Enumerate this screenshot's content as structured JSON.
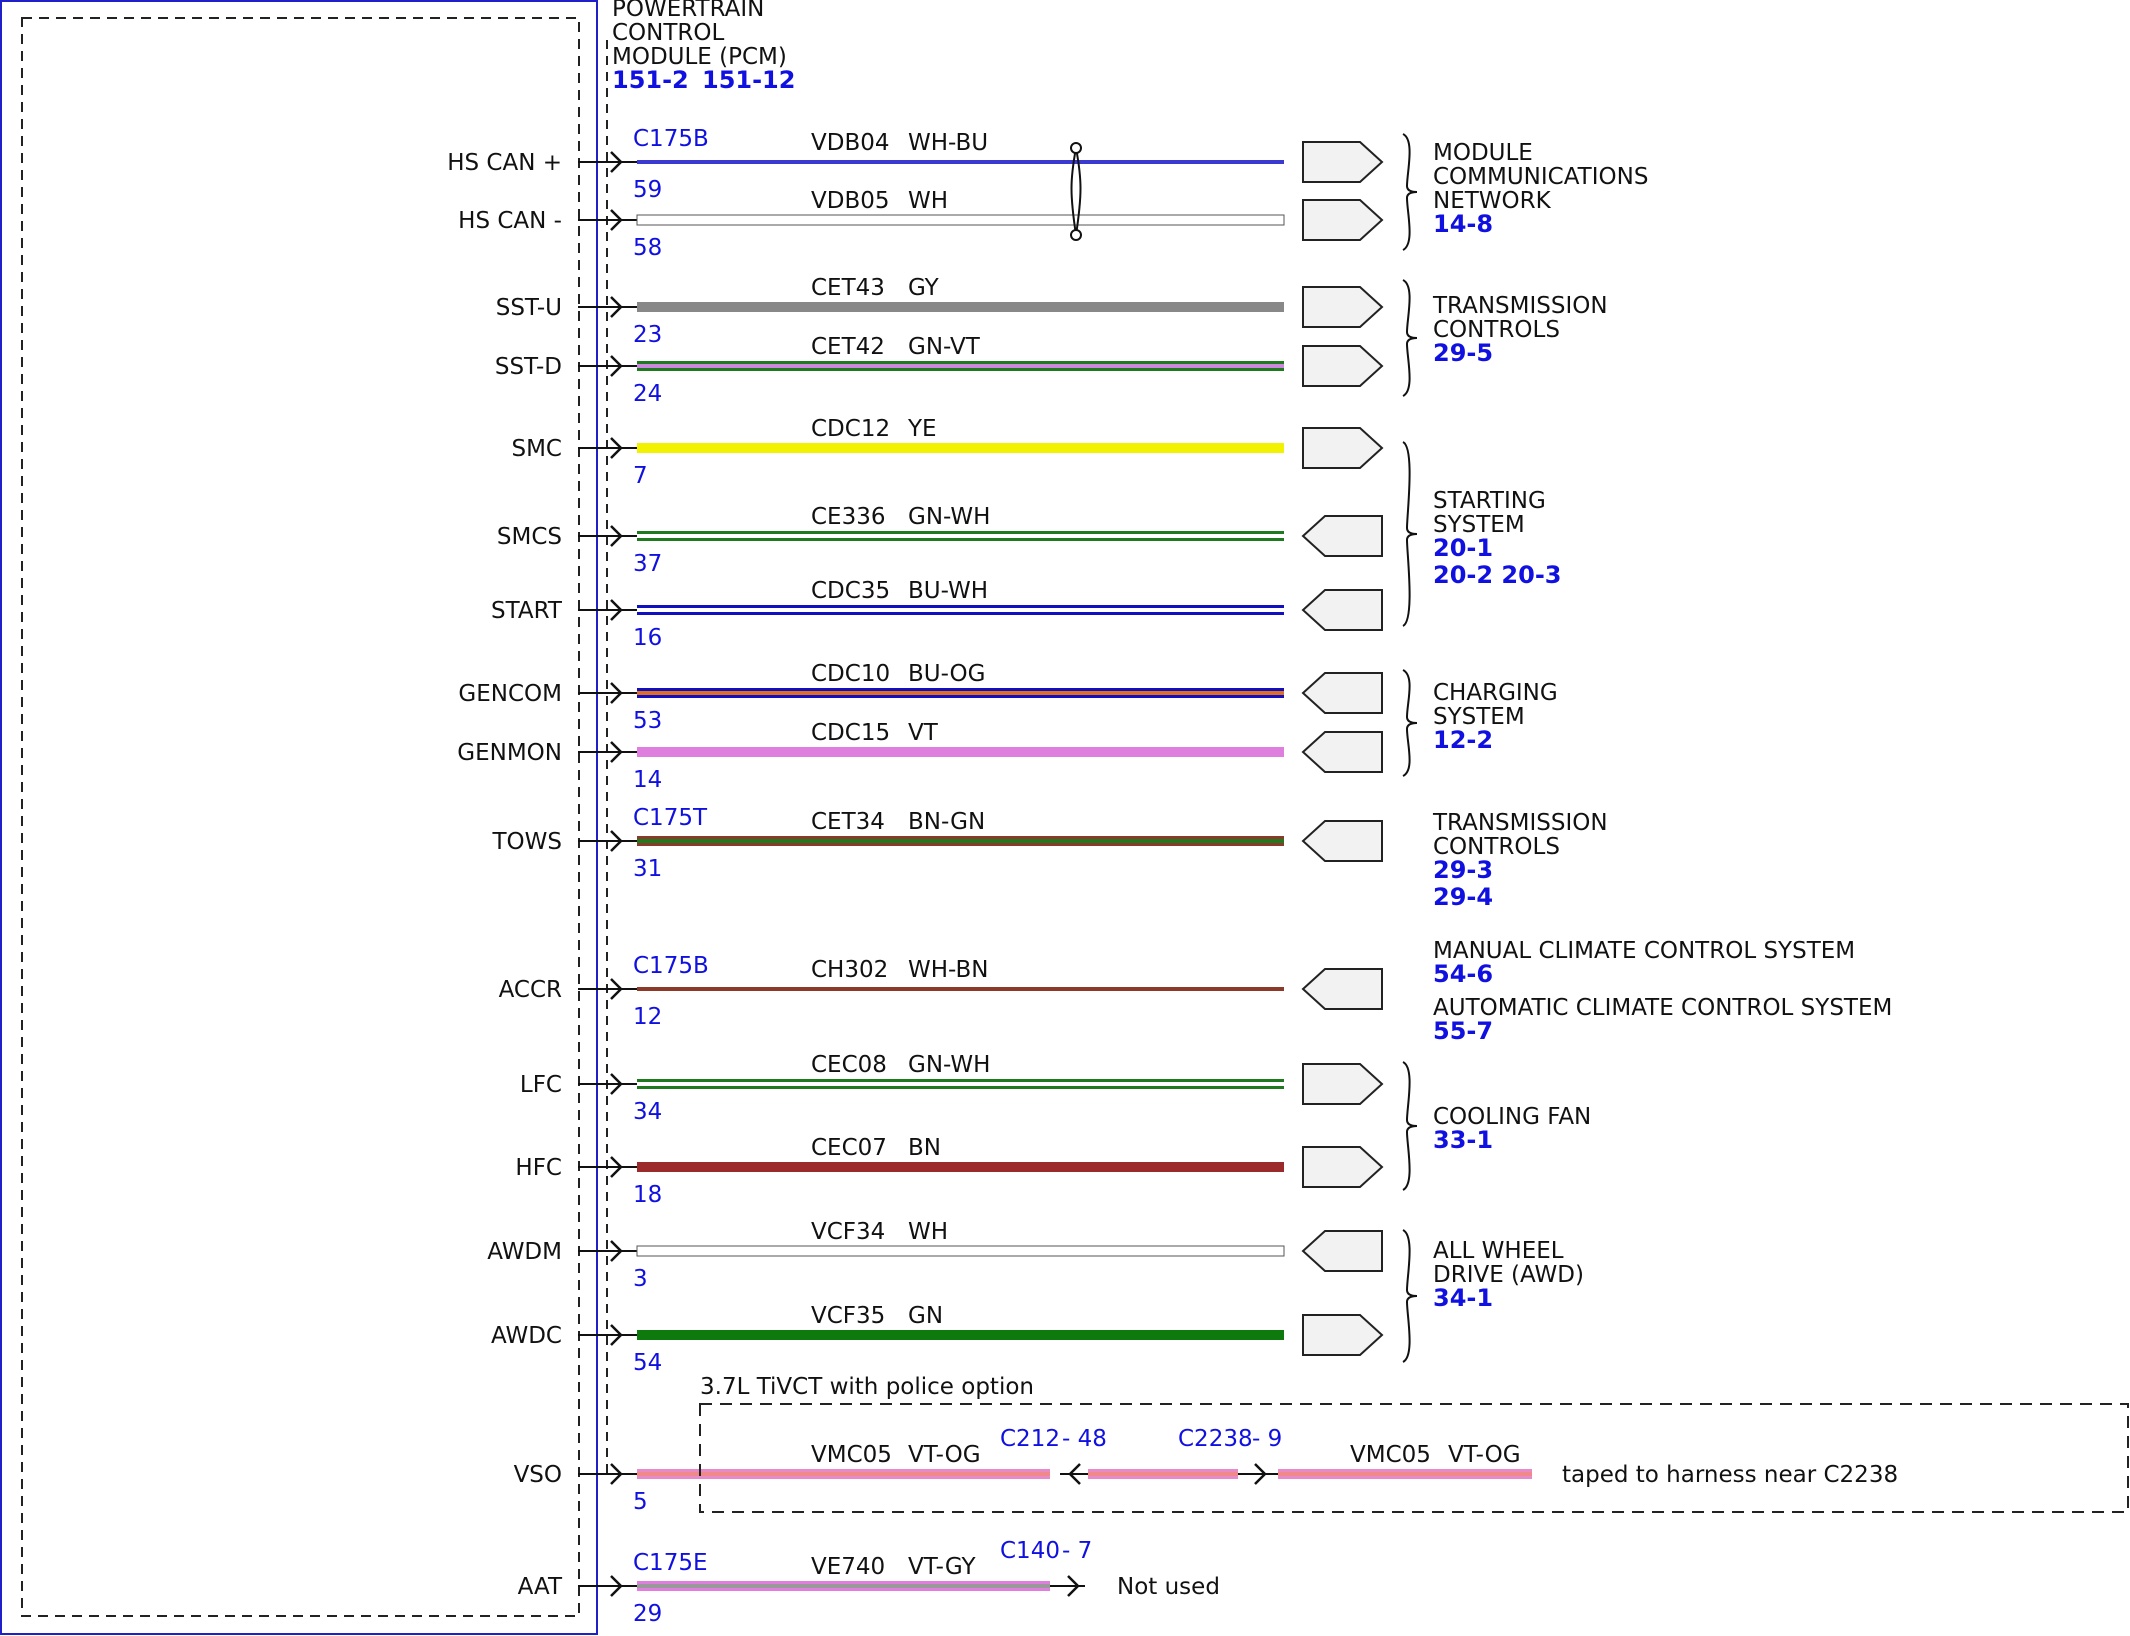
{
  "module": {
    "title_lines": [
      "POWERTRAIN",
      "CONTROL",
      "MODULE (PCM)"
    ],
    "refs": [
      "151-2",
      "151-12"
    ]
  },
  "circuits": [
    {
      "signal": "HS CAN +",
      "connector": "C175B",
      "pin": "59",
      "circuit": "VDB04",
      "color_code": "WH-BU",
      "wire_colors": [
        "#ffffff",
        "#3a3ad0"
      ],
      "dir": "out"
    },
    {
      "signal": "HS CAN -",
      "connector": "",
      "pin": "58",
      "circuit": "VDB05",
      "color_code": "WH",
      "wire_colors": [
        "#ffffff"
      ],
      "dir": "out"
    },
    {
      "signal": "SST-U",
      "connector": "",
      "pin": "23",
      "circuit": "CET43",
      "color_code": "GY",
      "wire_colors": [
        "#888888"
      ],
      "dir": "out"
    },
    {
      "signal": "SST-D",
      "connector": "",
      "pin": "24",
      "circuit": "CET42",
      "color_code": "GN-VT",
      "wire_colors": [
        "#1f7a1f",
        "#cc88dd"
      ],
      "dir": "out"
    },
    {
      "signal": "SMC",
      "connector": "",
      "pin": "7",
      "circuit": "CDC12",
      "color_code": "YE",
      "wire_colors": [
        "#f2f200"
      ],
      "dir": "out"
    },
    {
      "signal": "SMCS",
      "connector": "",
      "pin": "37",
      "circuit": "CE336",
      "color_code": "GN-WH",
      "wire_colors": [
        "#1f7a1f",
        "#ffffff"
      ],
      "dir": "in"
    },
    {
      "signal": "START",
      "connector": "",
      "pin": "16",
      "circuit": "CDC35",
      "color_code": "BU-WH",
      "wire_colors": [
        "#1010c0",
        "#ffffff"
      ],
      "dir": "in"
    },
    {
      "signal": "GENCOM",
      "connector": "",
      "pin": "53",
      "circuit": "CDC10",
      "color_code": "BU-OG",
      "wire_colors": [
        "#1010c0",
        "#e07020"
      ],
      "dir": "in"
    },
    {
      "signal": "GENMON",
      "connector": "",
      "pin": "14",
      "circuit": "CDC15",
      "color_code": "VT",
      "wire_colors": [
        "#e07ee0"
      ],
      "dir": "in"
    },
    {
      "signal": "TOWS",
      "connector": "C175T",
      "pin": "31",
      "circuit": "CET34",
      "color_code": "BN-GN",
      "wire_colors": [
        "#8b3a2a",
        "#1f7a1f"
      ],
      "dir": "in"
    },
    {
      "signal": "ACCR",
      "connector": "C175B",
      "pin": "12",
      "circuit": "CH302",
      "color_code": "WH-BN",
      "wire_colors": [
        "#ffffff",
        "#8b3a2a"
      ],
      "dir": "in"
    },
    {
      "signal": "LFC",
      "connector": "",
      "pin": "34",
      "circuit": "CEC08",
      "color_code": "GN-WH",
      "wire_colors": [
        "#1f7a1f",
        "#ffffff"
      ],
      "dir": "out"
    },
    {
      "signal": "HFC",
      "connector": "",
      "pin": "18",
      "circuit": "CEC07",
      "color_code": "BN",
      "wire_colors": [
        "#9b2a2a"
      ],
      "dir": "out"
    },
    {
      "signal": "AWDM",
      "connector": "",
      "pin": "3",
      "circuit": "VCF34",
      "color_code": "WH",
      "wire_colors": [
        "#ffffff"
      ],
      "dir": "in"
    },
    {
      "signal": "AWDC",
      "connector": "",
      "pin": "54",
      "circuit": "VCF35",
      "color_code": "GN",
      "wire_colors": [
        "#0e7a0e"
      ],
      "dir": "out"
    },
    {
      "signal": "VSO",
      "connector": "",
      "pin": "5",
      "circuit": "VMC05",
      "color_code": "VT-OG",
      "wire_colors": [
        "#e88ac8",
        "#f08a8a"
      ],
      "dir": "none"
    },
    {
      "signal": "AAT",
      "connector": "C175E",
      "pin": "29",
      "circuit": "VE740",
      "color_code": "VT-GY",
      "wire_colors": [
        "#e07ee0",
        "#999999"
      ],
      "dir": "none"
    }
  ],
  "groups": [
    {
      "label_lines": [
        "MODULE",
        "COMMUNICATIONS",
        "NETWORK"
      ],
      "refs": [
        "14-8"
      ]
    },
    {
      "label_lines": [
        "TRANSMISSION",
        "CONTROLS"
      ],
      "refs": [
        "29-5"
      ]
    },
    {
      "label_lines": [
        "STARTING",
        "SYSTEM"
      ],
      "refs": [
        "20-1",
        "20-2   20-3"
      ]
    },
    {
      "label_lines": [
        "CHARGING",
        "SYSTEM"
      ],
      "refs": [
        "12-2"
      ]
    },
    {
      "label_lines": [
        "TRANSMISSION",
        "CONTROLS"
      ],
      "refs": [
        "29-3",
        "29-4"
      ]
    },
    {
      "label_lines": [
        "MANUAL CLIMATE CONTROL SYSTEM"
      ],
      "refs": [
        "54-6"
      ]
    },
    {
      "label_lines": [
        "AUTOMATIC CLIMATE CONTROL SYSTEM"
      ],
      "refs": [
        "55-7"
      ]
    },
    {
      "label_lines": [
        "COOLING FAN"
      ],
      "refs": [
        "33-1"
      ]
    },
    {
      "label_lines": [
        "ALL WHEEL",
        "DRIVE (AWD)"
      ],
      "refs": [
        "34-1"
      ]
    }
  ],
  "vso_detail": {
    "option_label": "3.7L TiVCT with police option",
    "c212": "C212",
    "c212_pin": "- 48",
    "c2238": "C2238",
    "c2238_pin": "- 9",
    "circuit2": "VMC05",
    "color_code2": "VT-OG",
    "note": "taped to harness near C2238"
  },
  "aat_detail": {
    "c140": "C140",
    "c140_pin": "- 7",
    "note": "Not used"
  }
}
